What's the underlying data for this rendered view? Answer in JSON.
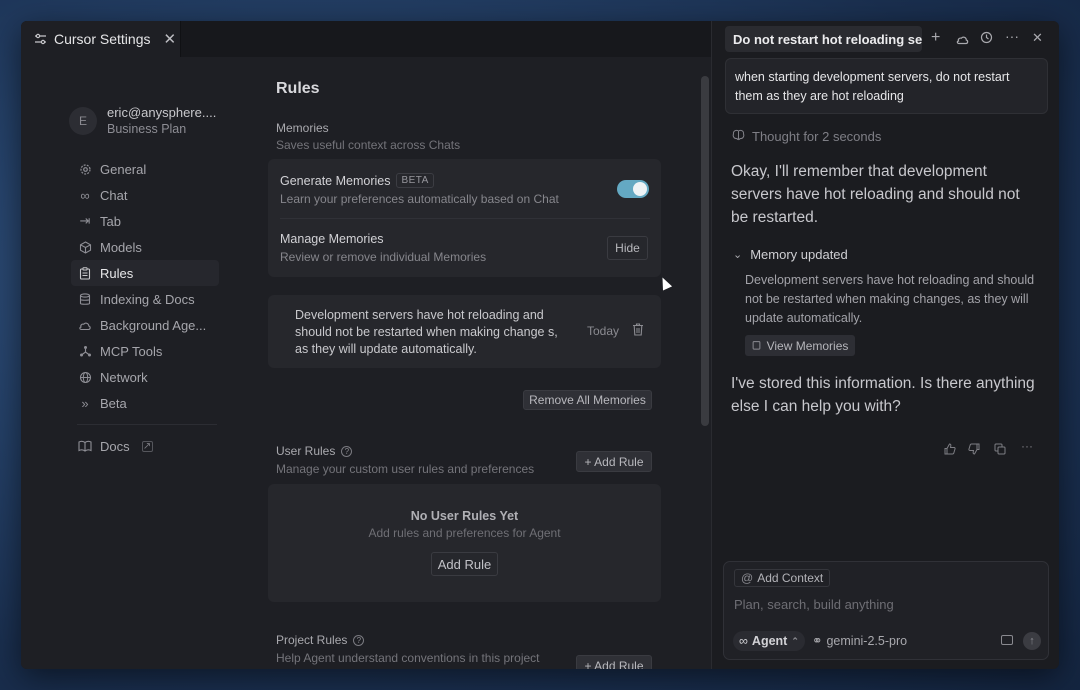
{
  "settings": {
    "tab": {
      "title": "Cursor Settings",
      "close": "✕"
    },
    "account": {
      "avatar": "E",
      "email": "eric@anysphere....",
      "plan": "Business Plan"
    },
    "nav": [
      {
        "label": "General",
        "icon": "gear-icon"
      },
      {
        "label": "Chat",
        "icon": "infinity-icon"
      },
      {
        "label": "Tab",
        "icon": "tab-arrow-icon"
      },
      {
        "label": "Models",
        "icon": "cube-icon"
      },
      {
        "label": "Rules",
        "icon": "clipboard-icon",
        "active": true
      },
      {
        "label": "Indexing & Docs",
        "icon": "database-icon"
      },
      {
        "label": "Background Age...",
        "icon": "cloud-icon"
      },
      {
        "label": "MCP Tools",
        "icon": "nodes-icon"
      },
      {
        "label": "Network",
        "icon": "globe-icon"
      },
      {
        "label": "Beta",
        "icon": "chevrons-icon"
      }
    ],
    "docs": "Docs",
    "page_title": "Rules",
    "memories": {
      "title": "Memories",
      "subtitle": "Saves useful context across Chats",
      "generate": {
        "title": "Generate Memories",
        "badge": "BETA",
        "subtitle": "Learn your preferences automatically based on Chat",
        "enabled": true
      },
      "manage": {
        "title": "Manage Memories",
        "subtitle": "Review or remove individual Memories",
        "button": "Hide"
      },
      "item": {
        "text": "Development servers have hot reloading and should not be restarted when making change s, as they will update automatically.",
        "date": "Today"
      },
      "remove_all": "Remove All Memories"
    },
    "user_rules": {
      "title": "User Rules",
      "subtitle": "Manage your custom user rules and preferences",
      "add": "+ Add Rule",
      "empty_title": "No User Rules Yet",
      "empty_sub": "Add rules and preferences for Agent",
      "empty_button": "Add Rule"
    },
    "project_rules": {
      "title": "Project Rules",
      "subtitle": "Help Agent understand conventions in this project",
      "add": "+ Add Rule"
    }
  },
  "chat": {
    "tab_title": "Do not restart hot reloading se",
    "user_message": "when starting development servers, do not restart them as they are hot reloading",
    "thought": "Thought for 2 seconds",
    "reply_1": "Okay, I'll remember that development servers have hot reloading and should not be restarted.",
    "memory_header": "Memory updated",
    "memory_body": "Development servers have hot reloading and should not be restarted when making changes, as they will update automatically.",
    "view_memories": "View Memories",
    "reply_2": "I've stored this information. Is there anything else I can help you with?",
    "input": {
      "add_context": "Add Context",
      "placeholder": "Plan, search, build anything",
      "mode": "Agent",
      "model": "gemini-2.5-pro"
    }
  }
}
